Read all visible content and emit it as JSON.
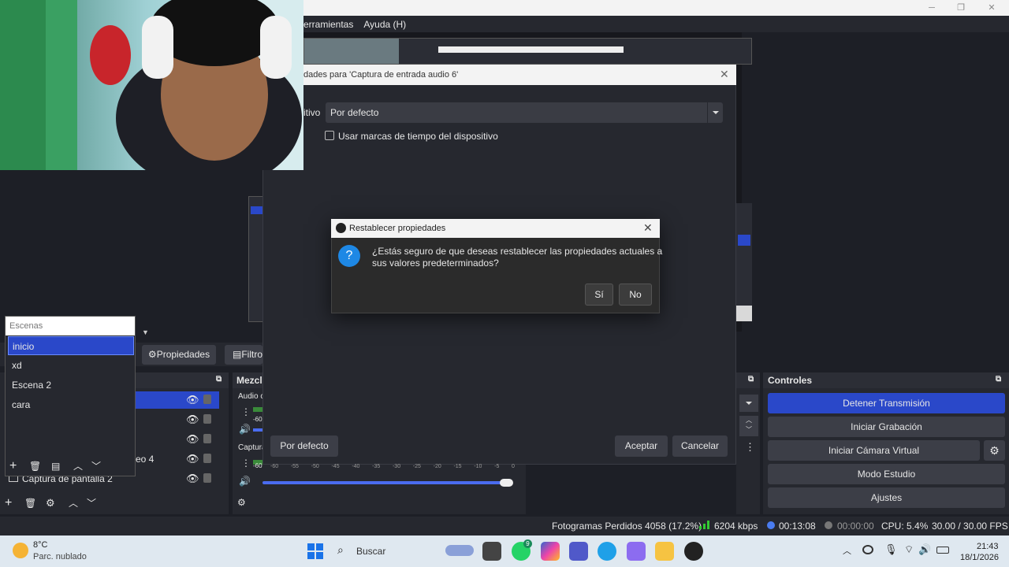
{
  "menu": [
    "erramientas",
    "Ayuda (H)"
  ],
  "properties_dialog": {
    "title": "dades para 'Captura de entrada audio 6'",
    "device_label": "itivo",
    "device_value": "Por defecto",
    "timestamps_label": "Usar marcas de tiempo del dispositivo",
    "defaults_button": "Por defecto",
    "accept_button": "Aceptar",
    "cancel_button": "Cancelar"
  },
  "reset_dialog": {
    "title": "Restablecer propiedades",
    "message_line1": "¿Estás seguro de que deseas restablecer las propiedades actuales a",
    "message_line2": "sus valores predeterminados?",
    "yes_button": "Sí",
    "no_button": "No"
  },
  "scenes_popup": {
    "placeholder": "Escenas",
    "items": [
      "inicio",
      "xd",
      "Escena 2",
      "cara"
    ],
    "selected": "inicio"
  },
  "toolbar": {
    "properties_button": "Propiedades",
    "filters_button": "Filtro"
  },
  "sources": {
    "partial_item": "eo 4",
    "last_item": "Captura de pantalla 2"
  },
  "mixer": {
    "header": "Mezcla",
    "audio_track": "Audio c",
    "capture_track": "Captura",
    "db_ticks": [
      "-60",
      "-55",
      "-50",
      "-45",
      "-40",
      "-35",
      "-30",
      "-25",
      "-20",
      "-15",
      "-10",
      "-5",
      "0"
    ]
  },
  "controls": {
    "header": "Controles",
    "stop_stream": "Detener Transmisión",
    "start_recording": "Iniciar Grabación",
    "start_virtual_cam": "Iniciar Cámara Virtual",
    "studio_mode": "Modo Estudio",
    "settings": "Ajustes"
  },
  "status": {
    "dropped_frames": "Fotogramas Perdidos 4058 (17.2%)",
    "bitrate": "6204 kbps",
    "stream_time": "00:13:08",
    "record_time": "00:00:00",
    "cpu": "CPU: 5.4%",
    "fps": "30.00 / 30.00 FPS"
  },
  "taskbar": {
    "temperature": "8°C",
    "weather": "Parc. nublado",
    "search_placeholder": "Buscar",
    "time": "21:43",
    "date": "18/1/2026",
    "whatsapp_badge": "9"
  },
  "colors": {
    "accent_blue": "#2a48c9",
    "panel": "#26282f",
    "meter_green": "#3a8a3a"
  }
}
